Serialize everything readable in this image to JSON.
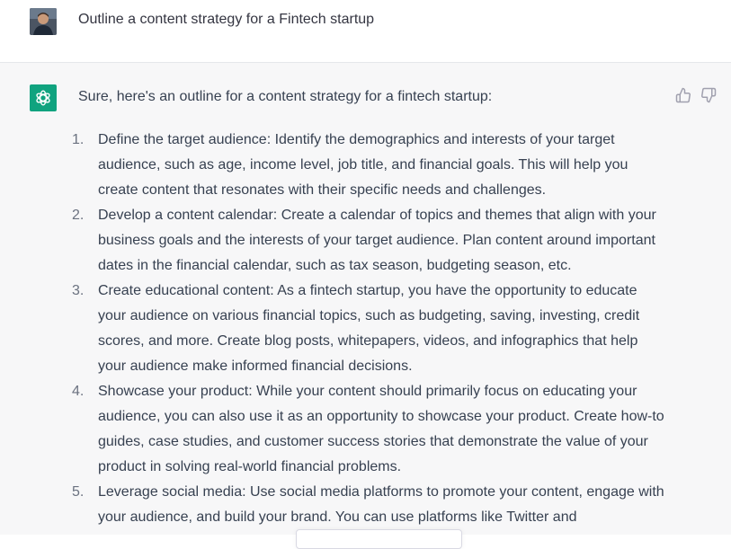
{
  "user_message": {
    "text": "Outline a content strategy for a Fintech startup",
    "avatar_icon": "user-avatar-photo"
  },
  "assistant_message": {
    "avatar_icon": "openai-logo-icon",
    "avatar_color": "#10a37f",
    "intro": "Sure, here's an outline for a content strategy for a fintech startup:",
    "items": [
      {
        "number": "1.",
        "text": "Define the target audience: Identify the demographics and interests of your target audience, such as age, income level, job title, and financial goals. This will help you create content that resonates with their specific needs and challenges."
      },
      {
        "number": "2.",
        "text": "Develop a content calendar: Create a calendar of topics and themes that align with your business goals and the interests of your target audience. Plan content around important dates in the financial calendar, such as tax season, budgeting season, etc."
      },
      {
        "number": "3.",
        "text": "Create educational content: As a fintech startup, you have the opportunity to educate your audience on various financial topics, such as budgeting, saving, investing, credit scores, and more. Create blog posts, whitepapers, videos, and infographics that help your audience make informed financial decisions."
      },
      {
        "number": "4.",
        "text": "Showcase your product: While your content should primarily focus on educating your audience, you can also use it as an opportunity to showcase your product. Create how-to guides, case studies, and customer success stories that demonstrate the value of your product in solving real-world financial problems."
      },
      {
        "number": "5.",
        "text": "Leverage social media: Use social media platforms to promote your content, engage with your audience, and build your brand. You can use platforms like Twitter and"
      }
    ]
  },
  "feedback": {
    "up_icon": "thumbs-up-icon",
    "down_icon": "thumbs-down-icon"
  }
}
